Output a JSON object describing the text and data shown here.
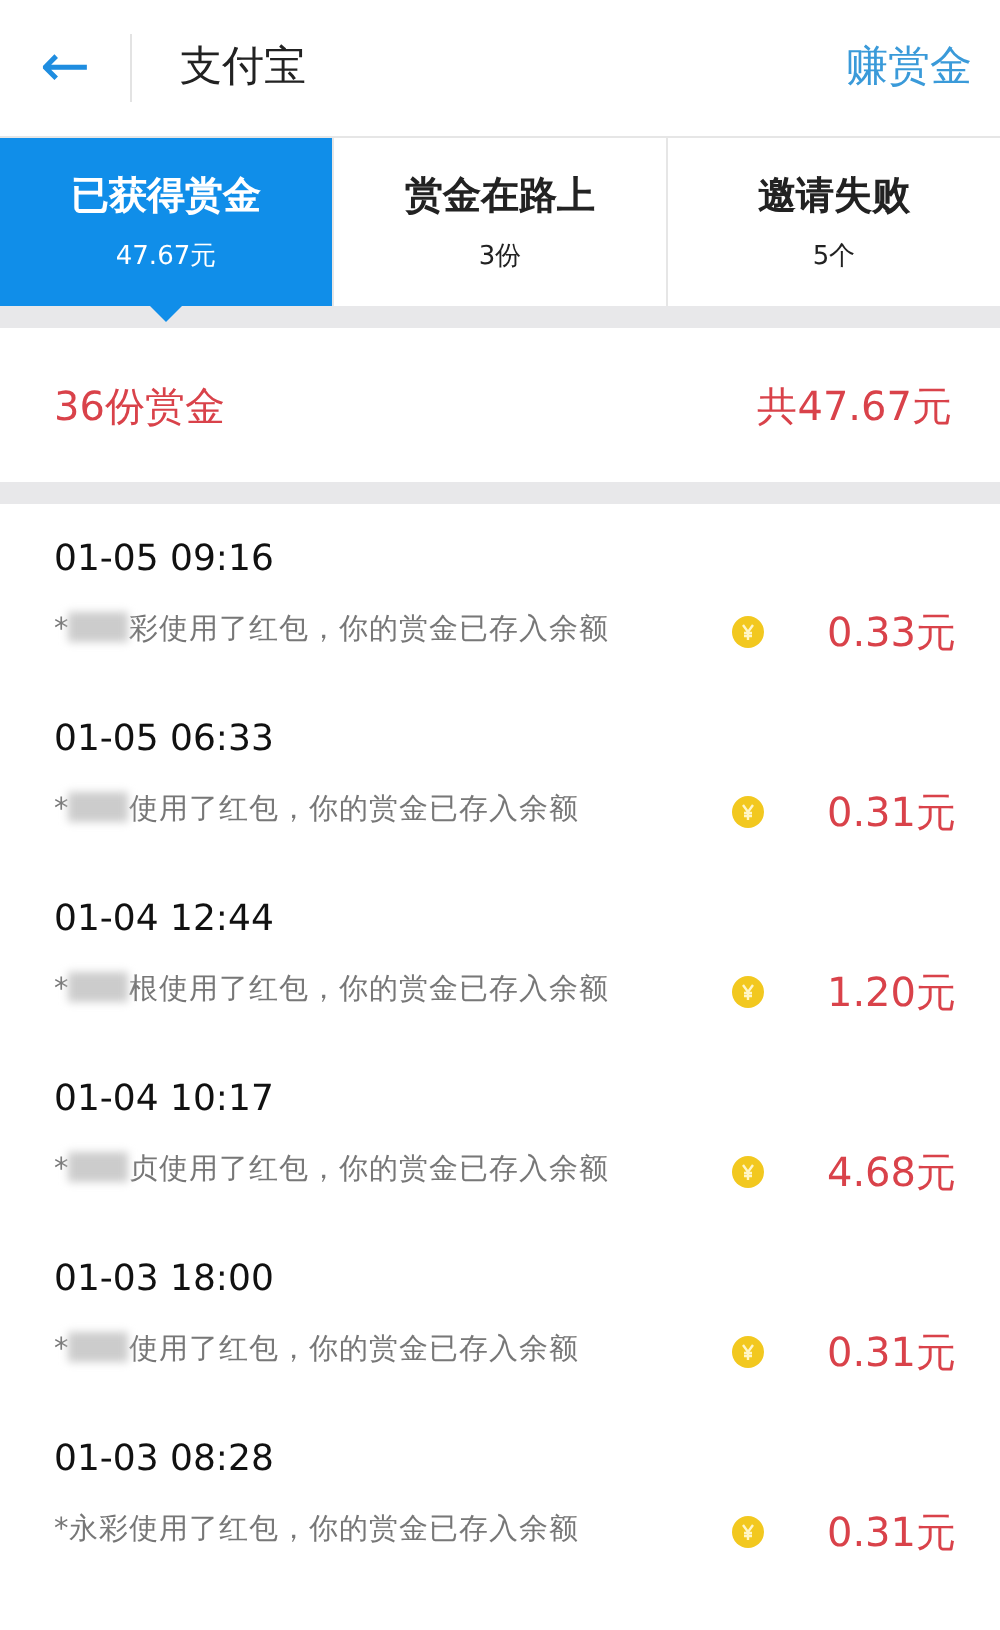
{
  "header": {
    "back": "←",
    "title": "支付宝",
    "action": "赚赏金"
  },
  "tabs": [
    {
      "label": "已获得赏金",
      "sub": "47.67元",
      "selected": true
    },
    {
      "label": "赏金在路上",
      "sub": "3份",
      "selected": false
    },
    {
      "label": "邀请失败",
      "sub": "5个",
      "selected": false
    }
  ],
  "summary": {
    "count": "36份赏金",
    "total": "共47.67元"
  },
  "records": [
    {
      "time": "01-05 09:16",
      "prefix": "*",
      "masked": true,
      "note": "彩使用了红包，你的赏金已存入余额",
      "amount": "0.33元"
    },
    {
      "time": "01-05 06:33",
      "prefix": "*",
      "masked": true,
      "note": "使用了红包，你的赏金已存入余额",
      "amount": "0.31元"
    },
    {
      "time": "01-04 12:44",
      "prefix": "*",
      "masked": true,
      "note": "根使用了红包，你的赏金已存入余额",
      "amount": "1.20元"
    },
    {
      "time": "01-04 10:17",
      "prefix": "*",
      "masked": true,
      "note": "贞使用了红包，你的赏金已存入余额",
      "amount": "4.68元"
    },
    {
      "time": "01-03 18:00",
      "prefix": "*",
      "masked": true,
      "note": "使用了红包，你的赏金已存入余额",
      "amount": "0.31元"
    },
    {
      "time": "01-03 08:28",
      "prefix": "*",
      "masked": false,
      "note": "永彩使用了红包，你的赏金已存入余额",
      "amount": "0.31元"
    }
  ]
}
